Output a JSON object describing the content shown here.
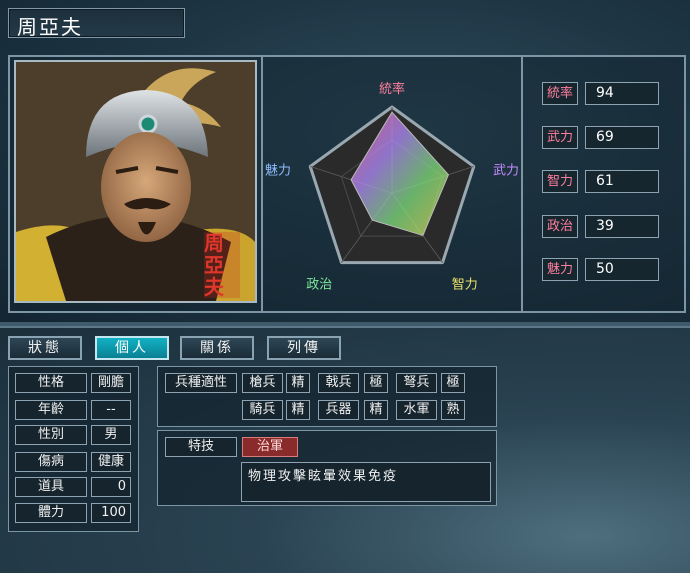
{
  "officer": {
    "name": "周亞夫",
    "seal_text": "周亞夫"
  },
  "stats": [
    {
      "label": "統率",
      "value": "94",
      "value_frac": 0.94
    },
    {
      "label": "武力",
      "value": "69",
      "value_frac": 0.69
    },
    {
      "label": "智力",
      "value": "61",
      "value_frac": 0.61
    },
    {
      "label": "政治",
      "value": "39",
      "value_frac": 0.39
    },
    {
      "label": "魅力",
      "value": "50",
      "value_frac": 0.5
    }
  ],
  "radar_labels": [
    "統率",
    "武力",
    "智力",
    "政治",
    "魅力"
  ],
  "radar_colors": {
    "統率": "#ff7e9c",
    "武力": "#c58cff",
    "智力": "#e8e06a",
    "政治": "#7ee89a",
    "魅力": "#8fbcff"
  },
  "tabs": [
    {
      "label": "狀態",
      "active": false
    },
    {
      "label": "個人",
      "active": true
    },
    {
      "label": "關係",
      "active": false
    },
    {
      "label": "列傳",
      "active": false
    }
  ],
  "personal": [
    {
      "label": "性格",
      "value": "剛膽"
    },
    {
      "label": "年齡",
      "value": "--"
    },
    {
      "label": "性別",
      "value": "男"
    },
    {
      "label": "傷病",
      "value": "健康"
    },
    {
      "label": "道具",
      "value": "0"
    },
    {
      "label": "體力",
      "value": "100"
    }
  ],
  "aptitude": {
    "title": "兵種適性",
    "items": [
      {
        "label": "槍兵",
        "value": "精"
      },
      {
        "label": "戟兵",
        "value": "極"
      },
      {
        "label": "弩兵",
        "value": "極"
      },
      {
        "label": "騎兵",
        "value": "精"
      },
      {
        "label": "兵器",
        "value": "精"
      },
      {
        "label": "水軍",
        "value": "熟"
      }
    ]
  },
  "special": {
    "label": "特技",
    "name": "治軍",
    "description": "物理攻擊眩暈效果免疫"
  },
  "colors": {
    "active_tab": "#0fa9bd",
    "skill_bg": "#8a2b2b",
    "stat_label": "#ff7e9c"
  }
}
